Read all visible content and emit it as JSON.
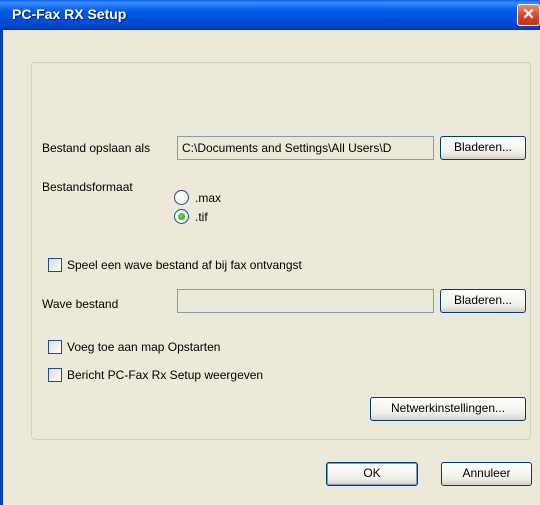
{
  "window": {
    "title": "PC-Fax RX Setup",
    "close_glyph": "✕"
  },
  "form": {
    "save_as_label": "Bestand opslaan als",
    "save_as_value": "C:\\Documents and Settings\\All Users\\D",
    "browse_label_1": "Bladeren...",
    "format_label": "Bestandsformaat",
    "format_options": [
      {
        "label": ".max",
        "checked": false
      },
      {
        "label": ".tif",
        "checked": true
      }
    ],
    "play_wave_label": "Speel een wave bestand af bij fax ontvangst",
    "wave_file_label": "Wave bestand",
    "wave_file_value": "",
    "browse_label_2": "Bladeren...",
    "startup_label": "Voeg toe aan map Opstarten",
    "show_msg_label": "Bericht PC-Fax Rx Setup weergeven",
    "network_button_label": "Netwerkinstellingen..."
  },
  "footer": {
    "ok_label": "OK",
    "cancel_label": "Annuleer"
  },
  "colors": {
    "titlebar": "#0058e6",
    "dialog_bg": "#ece9d8",
    "close_button": "#d5421f"
  }
}
